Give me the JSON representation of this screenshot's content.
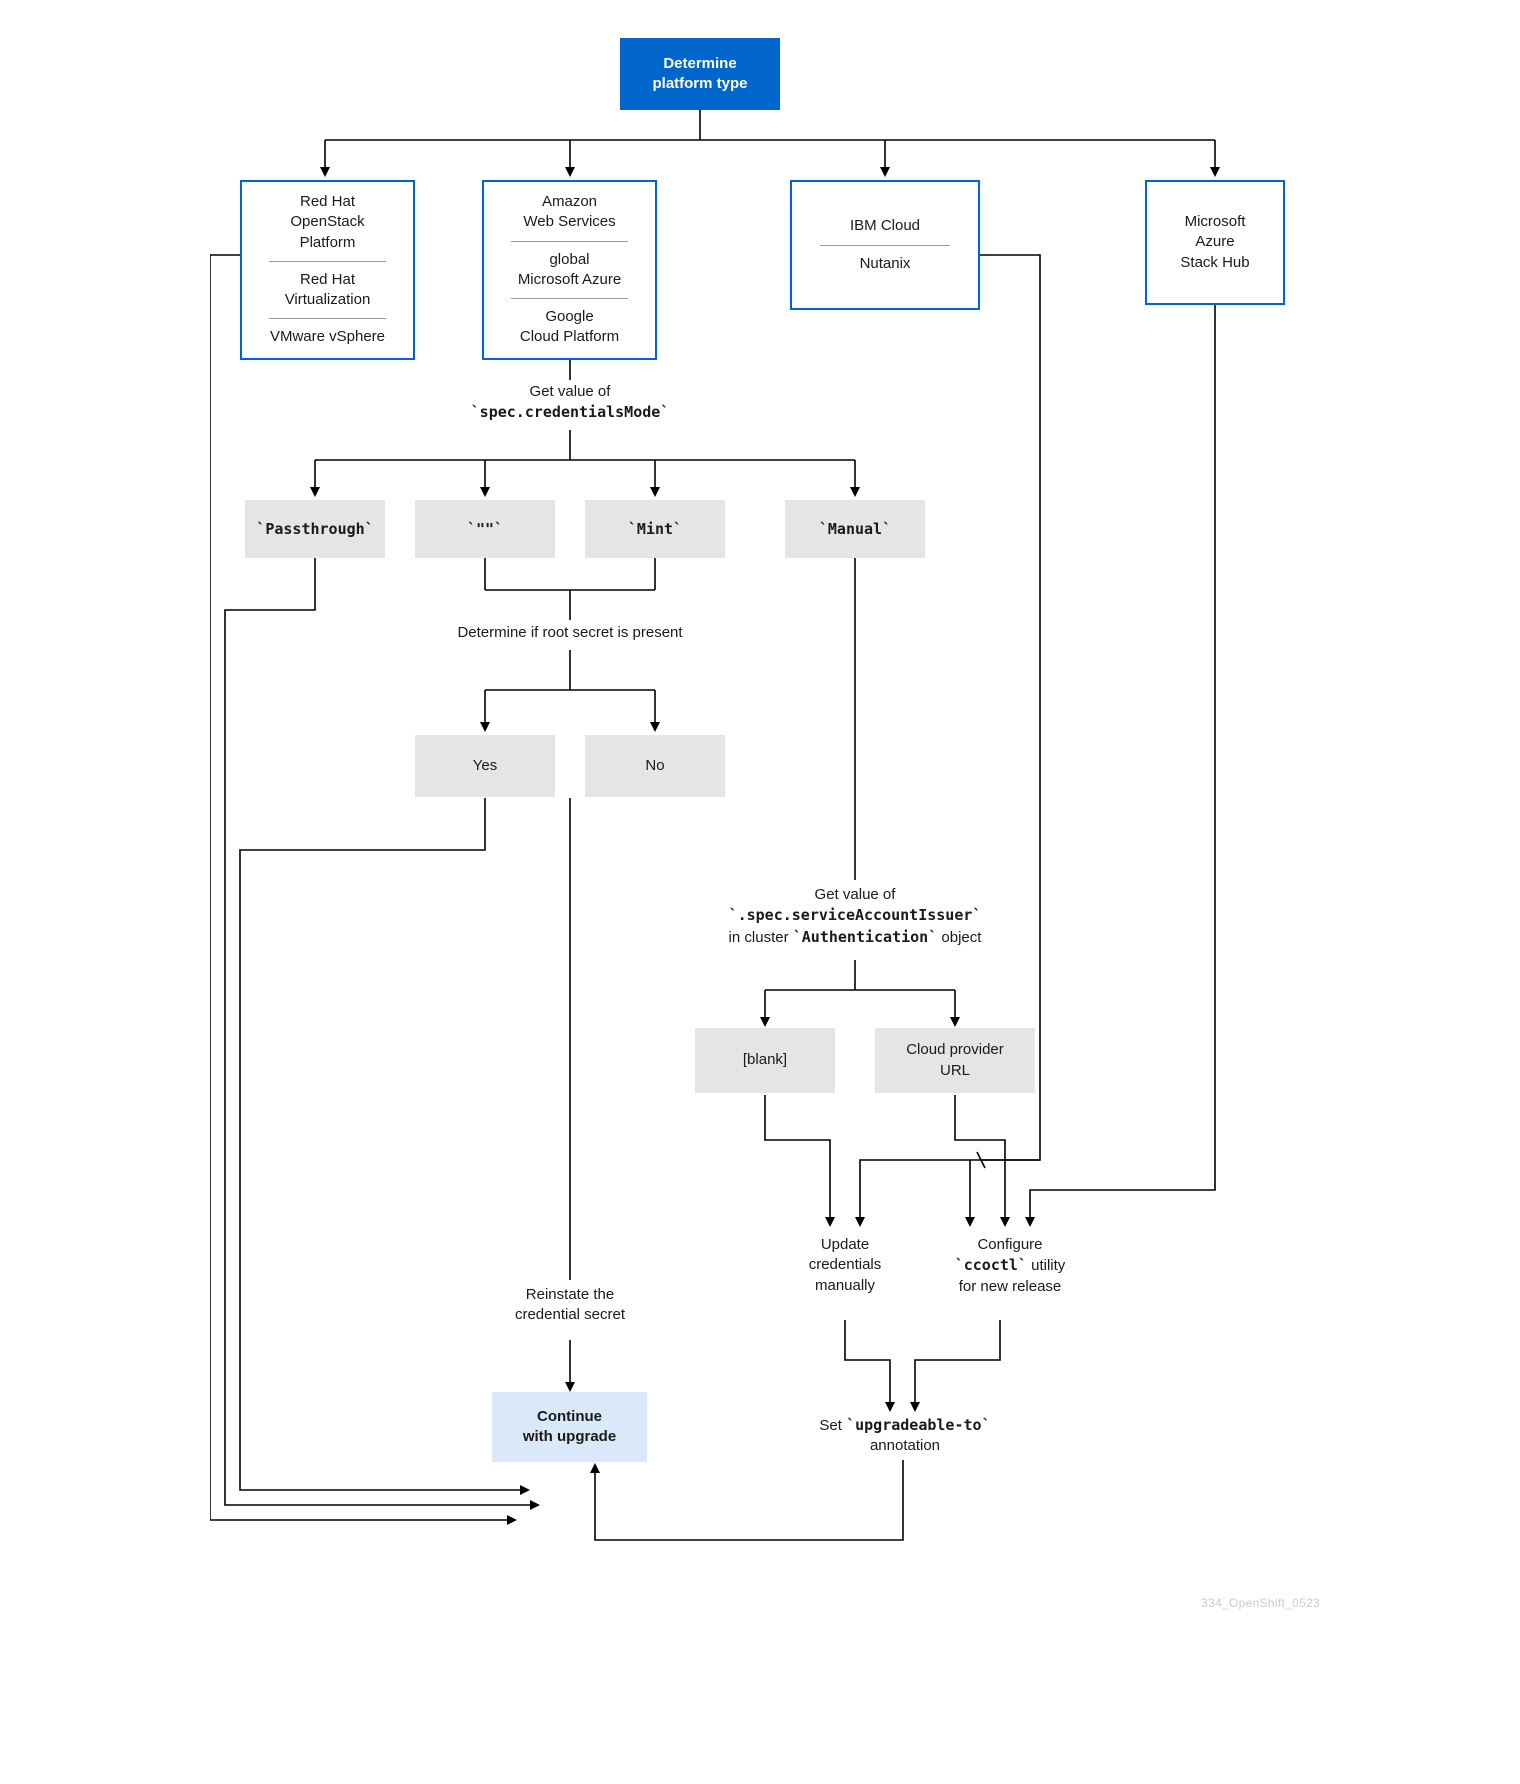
{
  "start": {
    "line1": "Determine",
    "line2": "platform type"
  },
  "platforms": {
    "p1": {
      "a": "Red Hat",
      "b": "OpenStack",
      "c": "Platform",
      "d": "Red Hat",
      "e": "Virtualization",
      "f": "VMware vSphere"
    },
    "p2": {
      "a": "Amazon",
      "b": "Web Services",
      "c": "global",
      "d": "Microsoft Azure",
      "e": "Google",
      "f": "Cloud Platform"
    },
    "p3": {
      "a": "IBM Cloud",
      "b": "Nutanix"
    },
    "p4": {
      "a": "Microsoft",
      "b": "Azure",
      "c": "Stack Hub"
    }
  },
  "labels": {
    "getCredMode_pre": "Get value of",
    "getCredMode_code": "`spec.credentialsMode`",
    "rootSecret": "Determine if root secret is present",
    "getSAI_pre": "Get value of",
    "getSAI_code": "`.spec.serviceAccountIssuer`",
    "getSAI_post_a": "in cluster ",
    "getSAI_post_b": "`Authentication`",
    "getSAI_post_c": " object",
    "reinstate_a": "Reinstate the",
    "reinstate_b": "credential secret",
    "updateCreds_a": "Update",
    "updateCreds_b": "credentials",
    "updateCreds_c": "manually",
    "configure_a": "Configure",
    "configure_code": "`ccoctl`",
    "configure_b": " utility",
    "configure_c": "for new release",
    "setUpg_a": "Set ",
    "setUpg_code": "`upgradeable-to`",
    "setUpg_b": "annotation"
  },
  "modes": {
    "passthrough": "`Passthrough`",
    "empty": "`\"\"`",
    "mint": "`Mint`",
    "manual": "`Manual`"
  },
  "yesno": {
    "yes": "Yes",
    "no": "No"
  },
  "sai": {
    "blank": "[blank]",
    "url_a": "Cloud provider",
    "url_b": "URL"
  },
  "continue": {
    "a": "Continue",
    "b": "with upgrade"
  },
  "watermark": "334_OpenShift_0523"
}
